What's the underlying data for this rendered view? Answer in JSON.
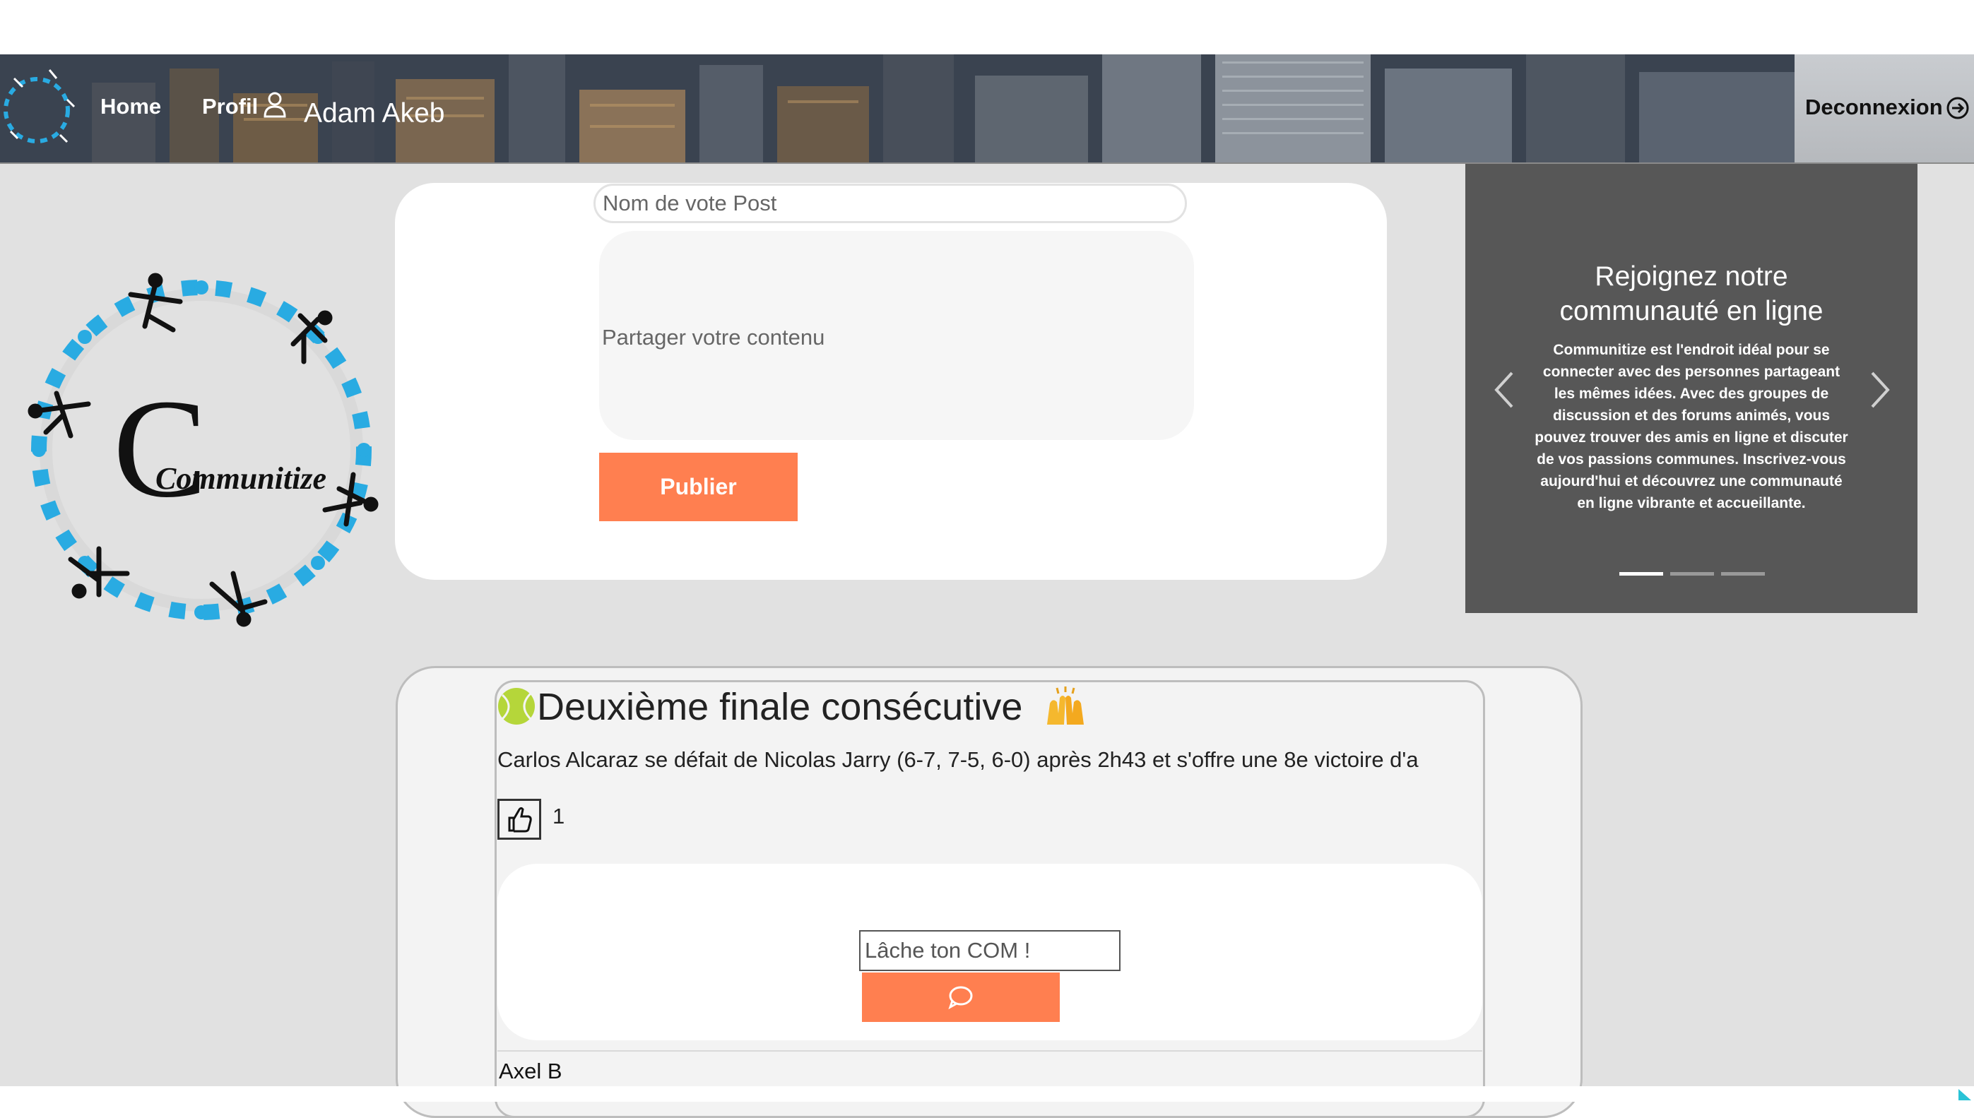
{
  "nav": {
    "home": "Home",
    "profil": "Profil",
    "user_name": "Adam Akeb",
    "logout": "Deconnexion"
  },
  "post_form": {
    "title_placeholder": "Nom de vote Post",
    "content_placeholder": "Partager votre contenu",
    "publish": "Publier"
  },
  "logo": {
    "brand": "Communitize"
  },
  "carousel": {
    "title": "Rejoignez notre communauté en ligne",
    "text": "Communitize est l'endroit idéal pour se connecter avec des personnes partageant les mêmes idées. Avec des groupes de discussion et des forums animés, vous pouvez trouver des amis en ligne et discuter de vos passions communes. Inscrivez-vous aujourd'hui et découvrez une communauté en ligne vibrante et accueillante.",
    "indicator_count": 3,
    "active_index": 0
  },
  "post": {
    "title": "Deuxième finale consécutive",
    "content": "Carlos Alcaraz se défait de Nicolas Jarry (6-7, 7-5, 6-0) après 2h43 et s'offre une 8e victoire d'a",
    "likes": "1",
    "comment_placeholder": "Lâche ton COM !",
    "comments": [
      {
        "author": "Axel  B"
      }
    ]
  },
  "colors": {
    "accent": "#ff7f50",
    "page_bg": "#e1e1e1",
    "carousel_bg": "#575757",
    "logo_blue": "#29abe2"
  }
}
